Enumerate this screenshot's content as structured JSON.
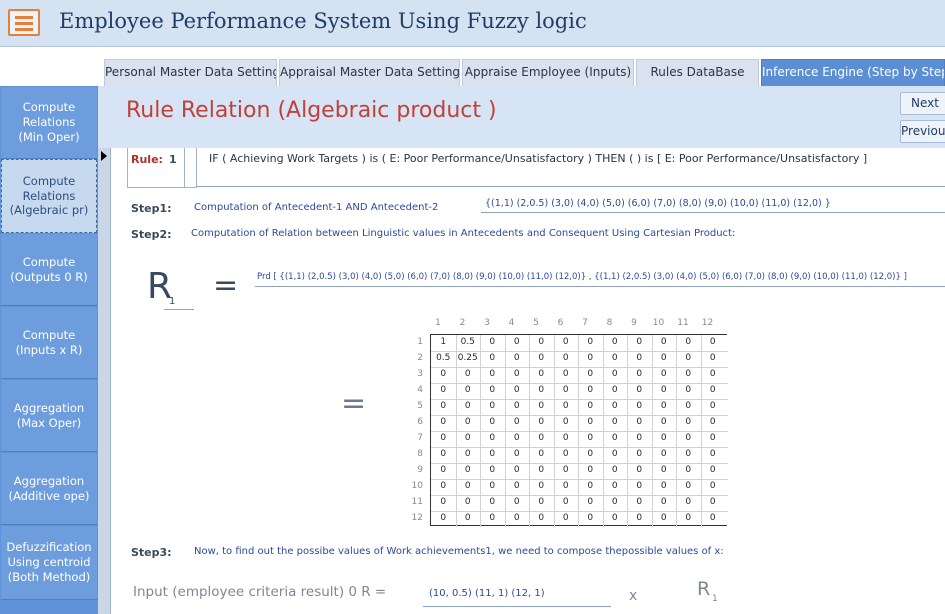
{
  "app": {
    "title": "Employee Performance System Using Fuzzy logic"
  },
  "tabs": [
    {
      "label": "Personal Master Data Setting"
    },
    {
      "label": "Appraisal Master Data Setting"
    },
    {
      "label": "Appraise Employee (Inputs)"
    },
    {
      "label": "Rules DataBase"
    },
    {
      "label": "Inference Engine (Step by Step)"
    }
  ],
  "nav": [
    {
      "label": "Compute\nRelations\n(Min Oper)"
    },
    {
      "label": "Compute\nRelations\n(Algebraic pr)"
    },
    {
      "label": "Compute\n(Outputs 0 R)"
    },
    {
      "label": "Compute\n(Inputs x R)"
    },
    {
      "label": "Aggregation\n(Max Oper)"
    },
    {
      "label": "Aggregation\n(Additive ope)"
    },
    {
      "label": "Defuzzification\nUsing centroid\n(Both Method)"
    }
  ],
  "header": {
    "title": "Rule Relation (Algebraic product )",
    "next_label": "Next",
    "previous_label": "Previous"
  },
  "rule": {
    "label": "Rule:",
    "number": "1",
    "text": "IF ( Achieving Work Targets ) is ( E: Poor Performance/Unsatisfactory ) THEN ( ) is [ E: Poor Performance/Unsatisfactory ]"
  },
  "step1": {
    "label": "Step1:",
    "desc": "Computation of  Antecedent-1  AND  Antecedent-2",
    "value": "{(1,1) (2,0.5)  (3,0)  (4,0)  (5,0)  (6,0)  (7,0)  (8,0)  (9,0)  (10,0)  (11,0)  (12,0) }"
  },
  "step2": {
    "label": "Step2:",
    "desc": "Computation of Relation between Linguistic values in Antecedents and Consequent Using Cartesian Product:"
  },
  "relation": {
    "symbol": "R",
    "subscript": "1",
    "equals": "=",
    "prd_text": "Prd [  {(1,1) (2,0.5) (3,0) (4,0) (5,0) (6,0) (7,0) (8,0) (9,0) (10,0) (11,0) (12,0)} ,    {(1,1) (2,0.5) (3,0) (4,0) (5,0) (6,0) (7,0) (8,0) (9,0) (10,0) (11,0) (12,0)}  ]",
    "equals2": "="
  },
  "matrix": {
    "col_headers": [
      "1",
      "2",
      "3",
      "4",
      "5",
      "6",
      "7",
      "8",
      "9",
      "10",
      "11",
      "12"
    ],
    "row_headers": [
      "1",
      "2",
      "3",
      "4",
      "5",
      "6",
      "7",
      "8",
      "9",
      "10",
      "11",
      "12"
    ],
    "rows": [
      [
        "1",
        "0.5",
        "0",
        "0",
        "0",
        "0",
        "0",
        "0",
        "0",
        "0",
        "0",
        "0"
      ],
      [
        "0.5",
        "0.25",
        "0",
        "0",
        "0",
        "0",
        "0",
        "0",
        "0",
        "0",
        "0",
        "0"
      ],
      [
        "0",
        "0",
        "0",
        "0",
        "0",
        "0",
        "0",
        "0",
        "0",
        "0",
        "0",
        "0"
      ],
      [
        "0",
        "0",
        "0",
        "0",
        "0",
        "0",
        "0",
        "0",
        "0",
        "0",
        "0",
        "0"
      ],
      [
        "0",
        "0",
        "0",
        "0",
        "0",
        "0",
        "0",
        "0",
        "0",
        "0",
        "0",
        "0"
      ],
      [
        "0",
        "0",
        "0",
        "0",
        "0",
        "0",
        "0",
        "0",
        "0",
        "0",
        "0",
        "0"
      ],
      [
        "0",
        "0",
        "0",
        "0",
        "0",
        "0",
        "0",
        "0",
        "0",
        "0",
        "0",
        "0"
      ],
      [
        "0",
        "0",
        "0",
        "0",
        "0",
        "0",
        "0",
        "0",
        "0",
        "0",
        "0",
        "0"
      ],
      [
        "0",
        "0",
        "0",
        "0",
        "0",
        "0",
        "0",
        "0",
        "0",
        "0",
        "0",
        "0"
      ],
      [
        "0",
        "0",
        "0",
        "0",
        "0",
        "0",
        "0",
        "0",
        "0",
        "0",
        "0",
        "0"
      ],
      [
        "0",
        "0",
        "0",
        "0",
        "0",
        "0",
        "0",
        "0",
        "0",
        "0",
        "0",
        "0"
      ],
      [
        "0",
        "0",
        "0",
        "0",
        "0",
        "0",
        "0",
        "0",
        "0",
        "0",
        "0",
        "0"
      ]
    ]
  },
  "step3": {
    "label": "Step3:",
    "desc": "Now, to find out the possibe values of Work achievements1, we need to compose thepossible values of x:"
  },
  "input_line": {
    "label": "Input (employee criteria result) 0 R   =",
    "value": "(10, 0.5) (11, 1) (12, 1)",
    "x_symbol": "x",
    "r_symbol": "R",
    "r_subscript": "1"
  }
}
